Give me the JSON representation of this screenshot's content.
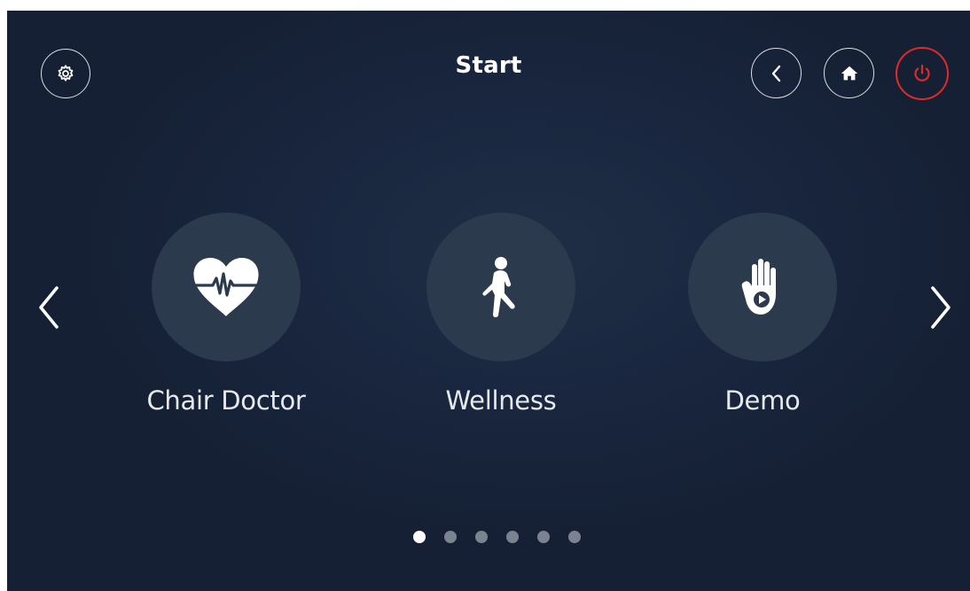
{
  "header": {
    "title": "Start"
  },
  "colors": {
    "background": "#1a2740",
    "tile_circle": "#2c3a4e",
    "power_accent": "#e02a2a",
    "dot_inactive": "#7b8390",
    "dot_active": "#ffffff"
  },
  "toolbar": {
    "settings_icon": "gear-icon",
    "back_icon": "chevron-left-icon",
    "home_icon": "home-icon",
    "power_icon": "power-icon"
  },
  "carousel": {
    "items": [
      {
        "label": "Chair Doctor",
        "icon": "heart-pulse-icon"
      },
      {
        "label": "Wellness",
        "icon": "walking-person-icon"
      },
      {
        "label": "Demo",
        "icon": "hand-play-icon"
      }
    ],
    "page_count": 6,
    "active_page": 1
  }
}
